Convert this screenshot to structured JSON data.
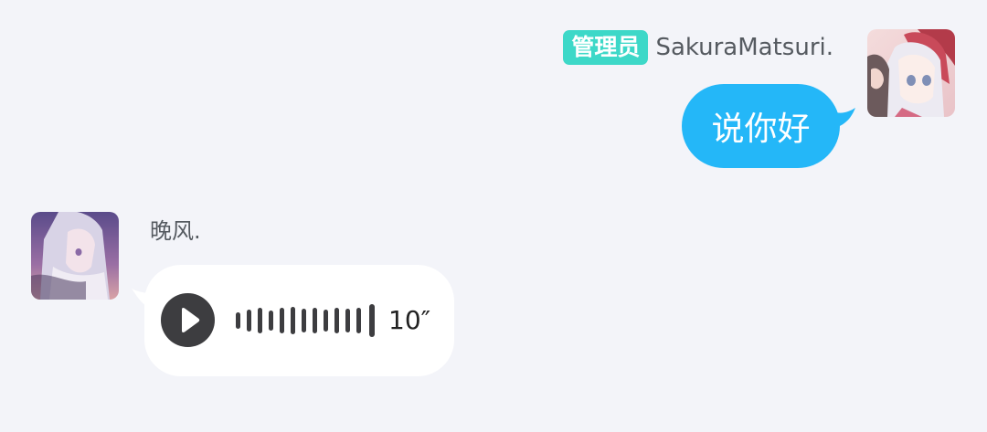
{
  "messages": [
    {
      "direction": "outgoing",
      "sender": {
        "role_badge": "管理员",
        "name": "SakuraMatsuri.",
        "avatar_icon": "anime-girl-avatar"
      },
      "type": "text",
      "text": "说你好",
      "bubble_color": "#24b7f8"
    },
    {
      "direction": "incoming",
      "sender": {
        "name": "晚风.",
        "avatar_icon": "anime-girl-avatar"
      },
      "type": "voice",
      "duration_label": "10″",
      "play_icon": "play-icon",
      "waveform_icon": "waveform-icon",
      "bubble_color": "#ffffff"
    }
  ],
  "colors": {
    "background": "#f3f4f9",
    "role_badge": "#3dd8c8",
    "outgoing_bubble": "#24b7f8",
    "play_button": "#3d3d40"
  }
}
